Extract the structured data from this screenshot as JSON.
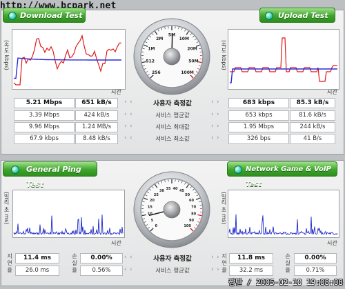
{
  "watermark": "http://www.bcpark.net",
  "footer": "짱단 / 2005-02-10 19:08:08",
  "labels": {
    "speed_axis": "(속도 kbps)",
    "ping_axis": "(밀리 초 ms)",
    "time": "시간",
    "user_measure": "사용자 측정값",
    "service_avg": "서비스 평균값",
    "service_max": "서비스 최대값",
    "service_min": "서비스 최소값",
    "latency": "지연율",
    "loss": "손실율"
  },
  "download": {
    "title": "Download Test",
    "rows": [
      {
        "kbps": "5.21 Mbps",
        "kBs": "651 kB/s"
      },
      {
        "kbps": "3.39 Mbps",
        "kBs": "424 kB/s"
      },
      {
        "kbps": "9.96 Mbps",
        "kBs": "1.24 MB/s"
      },
      {
        "kbps": "67.9 kbps",
        "kBs": "8.48 kB/s"
      }
    ]
  },
  "upload": {
    "title": "Upload Test",
    "rows": [
      {
        "kbps": "683 kbps",
        "kBs": "85.3 kB/s"
      },
      {
        "kbps": "653 kbps",
        "kBs": "81.6 kB/s"
      },
      {
        "kbps": "1.95 Mbps",
        "kBs": "244 kB/s"
      },
      {
        "kbps": "326 bps",
        "kBs": "41 B/s"
      }
    ]
  },
  "speed_gauge": {
    "ticks": [
      "256",
      "512",
      "1M",
      "2M",
      "5M",
      "10M",
      "20M",
      "50M",
      "100M"
    ],
    "reading_mbps": 5.21
  },
  "ping": {
    "title": "General Ping Test",
    "rows": [
      {
        "latency": "11.4 ms",
        "loss": "0.00%"
      },
      {
        "latency": "26.0 ms",
        "loss": "0.56%"
      }
    ]
  },
  "voip": {
    "title": "Network Game & VoIP Test",
    "rows": [
      {
        "latency": "11.8 ms",
        "loss": "0.00%"
      },
      {
        "latency": "32.2 ms",
        "loss": "0.71%"
      }
    ]
  },
  "ping_gauge": {
    "ticks": [
      "0",
      "5",
      "10",
      "15",
      "20",
      "25",
      "30",
      "35",
      "40",
      "45",
      "50",
      "60",
      "70",
      "80",
      "90",
      "100"
    ],
    "reading_ms": 11.4
  },
  "colors": {
    "tab_green": "#3ea52a",
    "red_line": "#e01818",
    "blue_line": "#2a2ad8",
    "ping_line": "#1c28c8"
  }
}
